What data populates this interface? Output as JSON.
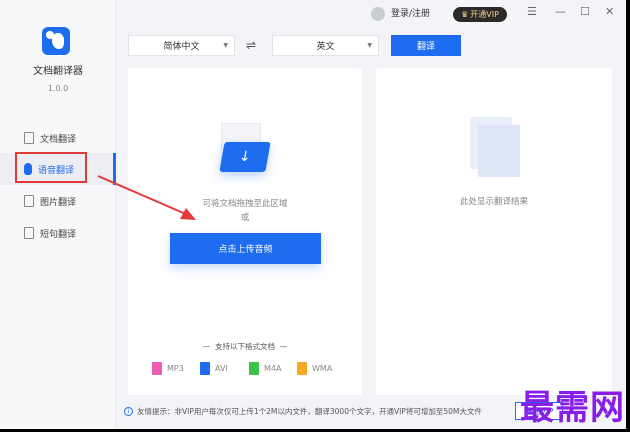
{
  "app": {
    "name": "文档翻译器",
    "version": "1.0.0"
  },
  "sidebar": {
    "items": [
      {
        "label": "文档翻译",
        "icon": "document-icon"
      },
      {
        "label": "语音翻译",
        "icon": "microphone-icon",
        "active": true
      },
      {
        "label": "图片翻译",
        "icon": "image-icon"
      },
      {
        "label": "短句翻译",
        "icon": "text-icon"
      }
    ]
  },
  "header": {
    "login": "登录/注册",
    "vip": "开通VIP"
  },
  "toolbar": {
    "source_lang": "简体中文",
    "target_lang": "英文",
    "swap": "⇌",
    "translate": "翻译"
  },
  "upload": {
    "drag_hint": "可将文档拖拽至此区域",
    "or": "或",
    "button": "点击上传音频",
    "formats_title": "支持以下格式文档",
    "formats": [
      {
        "label": "MP3",
        "color": "#f05bb5"
      },
      {
        "label": "AVI",
        "color": "#1e6cf0"
      },
      {
        "label": "M4A",
        "color": "#3cc24a"
      },
      {
        "label": "WMA",
        "color": "#f9a825"
      }
    ]
  },
  "result": {
    "hint": "此处显示翻译结果"
  },
  "footer": {
    "tip": "友情提示：非VIP用户每次仅可上传1个2M以内文件，翻译3000个文字，开通VIP将可增加至50M大文件",
    "vip_button": "开通VIP"
  },
  "watermark": "最需网",
  "colors": {
    "accent": "#1e6cf0",
    "highlight": "#e23a3a"
  }
}
